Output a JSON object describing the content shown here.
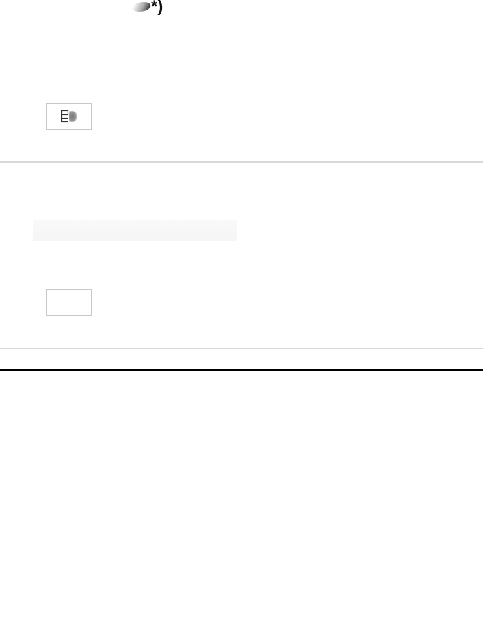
{
  "header": {
    "visible_text": "*)"
  },
  "sections": [
    {
      "button": {
        "icon": "split-view-icon"
      }
    },
    {
      "button": {
        "icon": ""
      }
    }
  ],
  "colors": {
    "divider": "#d9d9d9",
    "heavy_divider": "#000000",
    "button_border": "#c8c8c8",
    "icon_gray": "#555555"
  }
}
